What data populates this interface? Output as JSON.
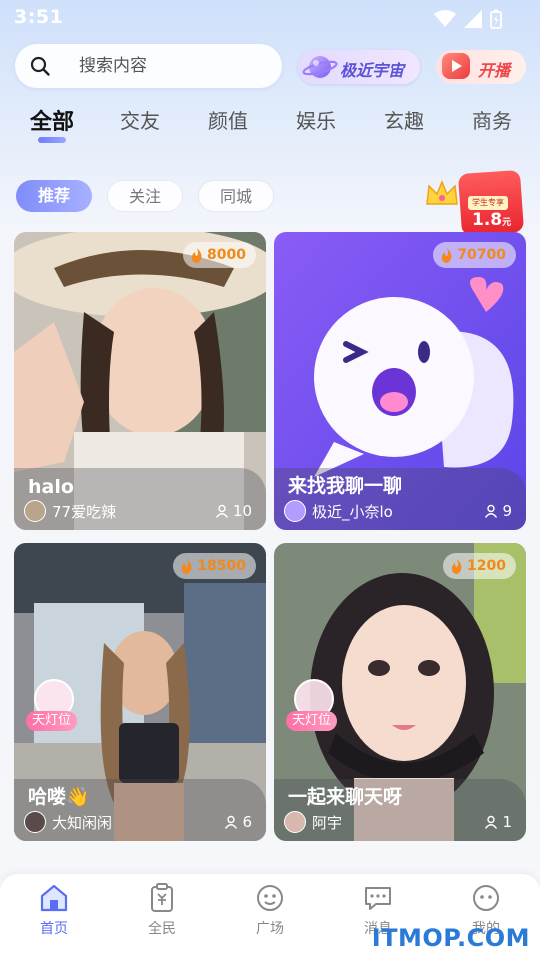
{
  "status_bar": {
    "time": "3:51"
  },
  "search": {
    "placeholder": "搜索内容"
  },
  "header_buttons": {
    "universe_label": "极近宇宙",
    "live_label": "开播"
  },
  "categories": [
    "全部",
    "交友",
    "颜值",
    "娱乐",
    "玄趣",
    "商务"
  ],
  "active_category": "全部",
  "sub_tabs": [
    "推荐",
    "关注",
    "同城"
  ],
  "active_sub_tab": "推荐",
  "promo": {
    "tag": "学生专享",
    "price": "1.8",
    "unit": "元"
  },
  "rooms": [
    {
      "title": "halo",
      "host": "77爱吃辣",
      "heat": "8000",
      "viewers": "10",
      "badge": ""
    },
    {
      "title": "来找我聊一聊",
      "host": "极近_小奈lo",
      "heat": "70700",
      "viewers": "9",
      "badge": ""
    },
    {
      "title": "哈喽👋",
      "host": "大知闲闲",
      "heat": "18500",
      "viewers": "6",
      "badge": "天灯位"
    },
    {
      "title": "一起来聊天呀",
      "host": "阿宇",
      "heat": "1200",
      "viewers": "1",
      "badge": "天灯位"
    }
  ],
  "nav": [
    "首页",
    "全民",
    "广场",
    "消息",
    "我的"
  ],
  "active_nav": "首页",
  "watermark": "ITMOP.COM",
  "colors": {
    "accent": "#6f7cf8",
    "heat": "#f08a1c",
    "live": "#f0464a",
    "universe": "#5a52d8"
  }
}
